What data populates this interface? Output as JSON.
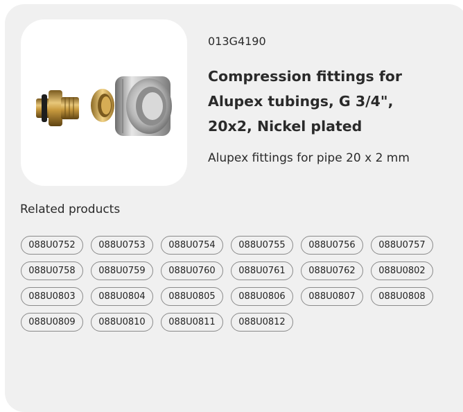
{
  "product": {
    "sku": "013G4190",
    "title": "Compression fittings for Alupex tubings, G 3/4\", 20x2, Nickel plated",
    "description": "Alupex fittings for pipe 20 x 2 mm",
    "image_icon": "compression-fitting-product-photo"
  },
  "related": {
    "heading": "Related products",
    "items": [
      "088U0752",
      "088U0753",
      "088U0754",
      "088U0755",
      "088U0756",
      "088U0757",
      "088U0758",
      "088U0759",
      "088U0760",
      "088U0761",
      "088U0762",
      "088U0802",
      "088U0803",
      "088U0804",
      "088U0805",
      "088U0806",
      "088U0807",
      "088U0808",
      "088U0809",
      "088U0810",
      "088U0811",
      "088U0812"
    ]
  },
  "colors": {
    "card_background": "#f0f0f0",
    "chip_border": "#8a8a8a",
    "text": "#2a2a2a"
  }
}
